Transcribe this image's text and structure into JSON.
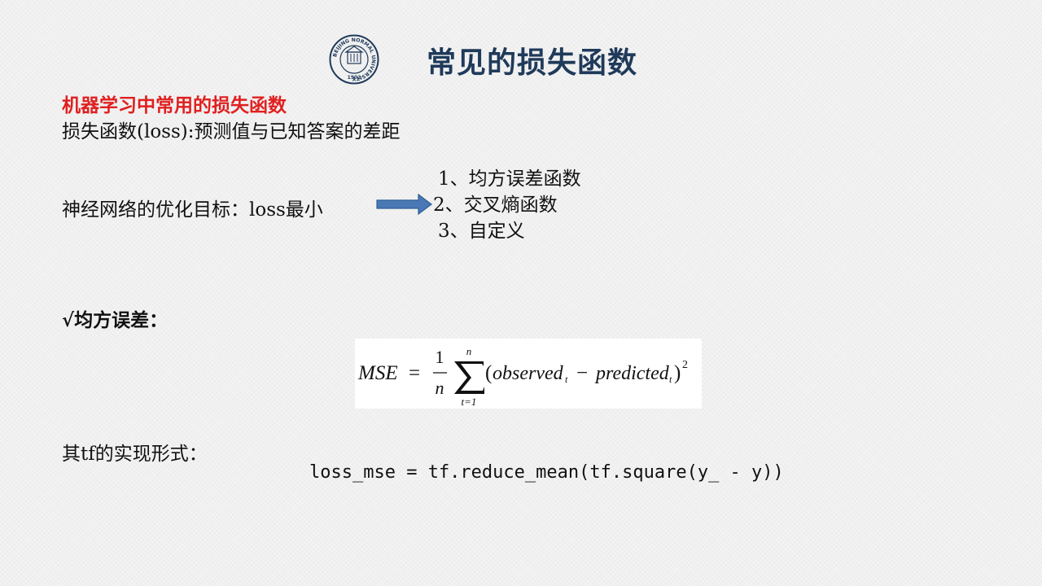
{
  "header": {
    "title": "常见的损失函数",
    "logo": {
      "icon": "university-seal-icon",
      "ring_text": "BEIJING NORMAL UNIVERSITY",
      "year": "1902",
      "color": "#1f3a5a"
    }
  },
  "content": {
    "subtitle": "机器学习中常用的损失函数",
    "definition": "损失函数(loss):预测值与已知答案的差距",
    "goal": "神经网络的优化目标：loss最小",
    "arrow_icon": "right-arrow-icon",
    "loss_types": [
      "1、均方误差函数",
      "2、交叉熵函数",
      "3、自定义"
    ],
    "mse_label": "√均方误差：",
    "formula": {
      "lhs": "MSE",
      "eq": "=",
      "numerator": "1",
      "denominator": "n",
      "sum_upper": "n",
      "sum_lower": "t=1",
      "body_open": "(",
      "observed": "observed",
      "sub_t": "t",
      "minus": "−",
      "predicted": "predicted",
      "body_close": ")",
      "power": "2"
    },
    "tf_label": "其tf的实现形式：",
    "code": "loss_mse = tf.reduce_mean(tf.square(y_ - y))"
  },
  "colors": {
    "accent_red": "#e02020",
    "title_blue": "#1f3a5a",
    "arrow_fill": "#4a78b4"
  }
}
